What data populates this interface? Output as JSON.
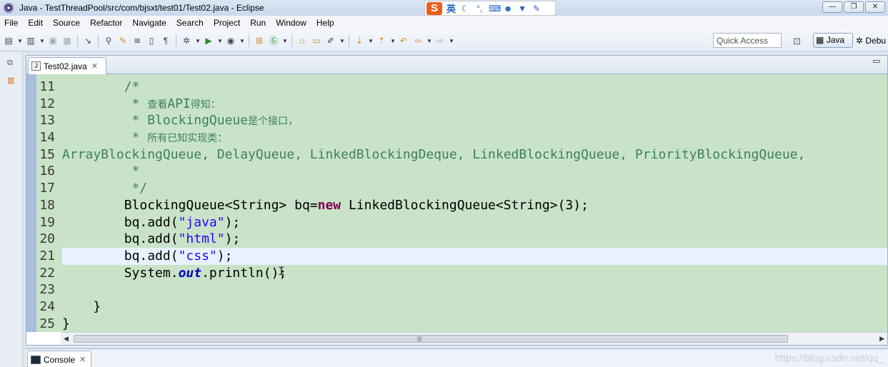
{
  "window": {
    "title": "Java - TestThreadPool/src/com/bjsxt/test01/Test02.java - Eclipse",
    "controls": [
      "—",
      "❐",
      "✕"
    ]
  },
  "ime": {
    "logo": "S",
    "mode": "英",
    "icons": [
      "moon-icon",
      "punctuation-icon",
      "keyboard-icon",
      "user-icon",
      "shirt-icon",
      "wrench-icon"
    ]
  },
  "menu": [
    "File",
    "Edit",
    "Source",
    "Refactor",
    "Navigate",
    "Search",
    "Project",
    "Run",
    "Window",
    "Help"
  ],
  "toolbar": {
    "quick_access": "Quick Access",
    "perspective_java": "Java",
    "perspective_debug": "Debu"
  },
  "editor": {
    "tab_label": "Test02.java",
    "tab_close": "✕",
    "current_line": 21,
    "lines": [
      {
        "num": "11",
        "segments": [
          {
            "t": "        ",
            "c": ""
          },
          {
            "t": "/*",
            "c": "cm"
          }
        ]
      },
      {
        "num": "12",
        "segments": [
          {
            "t": "         ",
            "c": ""
          },
          {
            "t": "* ",
            "c": "cm"
          },
          {
            "t": "查看",
            "c": "cm cm-cjk"
          },
          {
            "t": "API",
            "c": "cm"
          },
          {
            "t": "得知：",
            "c": "cm cm-cjk"
          }
        ]
      },
      {
        "num": "13",
        "segments": [
          {
            "t": "         ",
            "c": ""
          },
          {
            "t": "* BlockingQueue",
            "c": "cm"
          },
          {
            "t": "是个接口，",
            "c": "cm cm-cjk"
          }
        ]
      },
      {
        "num": "14",
        "segments": [
          {
            "t": "         ",
            "c": ""
          },
          {
            "t": "* ",
            "c": "cm"
          },
          {
            "t": "所有已知实现类：",
            "c": "cm cm-cjk"
          }
        ]
      },
      {
        "num": "15",
        "segments": [
          {
            "t": "ArrayBlockingQueue, DelayQueue, LinkedBlockingDeque, LinkedBlockingQueue, PriorityBlockingQueue,",
            "c": "cm"
          }
        ]
      },
      {
        "num": "16",
        "segments": [
          {
            "t": "         ",
            "c": ""
          },
          {
            "t": "*",
            "c": "cm"
          }
        ]
      },
      {
        "num": "17",
        "segments": [
          {
            "t": "         ",
            "c": ""
          },
          {
            "t": "*/",
            "c": "cm"
          }
        ]
      },
      {
        "num": "18",
        "segments": [
          {
            "t": "        BlockingQueue<String> bq=",
            "c": ""
          },
          {
            "t": "new",
            "c": "kw"
          },
          {
            "t": " LinkedBlockingQueue<String>(3);",
            "c": ""
          }
        ]
      },
      {
        "num": "19",
        "segments": [
          {
            "t": "        bq.add(",
            "c": ""
          },
          {
            "t": "\"java\"",
            "c": "str"
          },
          {
            "t": ");",
            "c": ""
          }
        ]
      },
      {
        "num": "20",
        "segments": [
          {
            "t": "        bq.add(",
            "c": ""
          },
          {
            "t": "\"html\"",
            "c": "str"
          },
          {
            "t": ");",
            "c": ""
          }
        ]
      },
      {
        "num": "21",
        "segments": [
          {
            "t": "        bq.add(",
            "c": ""
          },
          {
            "t": "\"css\"",
            "c": "str"
          },
          {
            "t": ");",
            "c": ""
          }
        ]
      },
      {
        "num": "22",
        "segments": [
          {
            "t": "        System.",
            "c": ""
          },
          {
            "t": "out",
            "c": "fld"
          },
          {
            "t": ".println();",
            "c": ""
          }
        ]
      },
      {
        "num": "23",
        "segments": [
          {
            "t": "",
            "c": ""
          }
        ]
      },
      {
        "num": "24",
        "segments": [
          {
            "t": "    }",
            "c": ""
          }
        ]
      },
      {
        "num": "25",
        "segments": [
          {
            "t": "}",
            "c": ""
          }
        ]
      }
    ]
  },
  "console": {
    "tab_label": "Console",
    "tab_close": "✕"
  },
  "watermark": "https://blog.csdn.net/qq_"
}
